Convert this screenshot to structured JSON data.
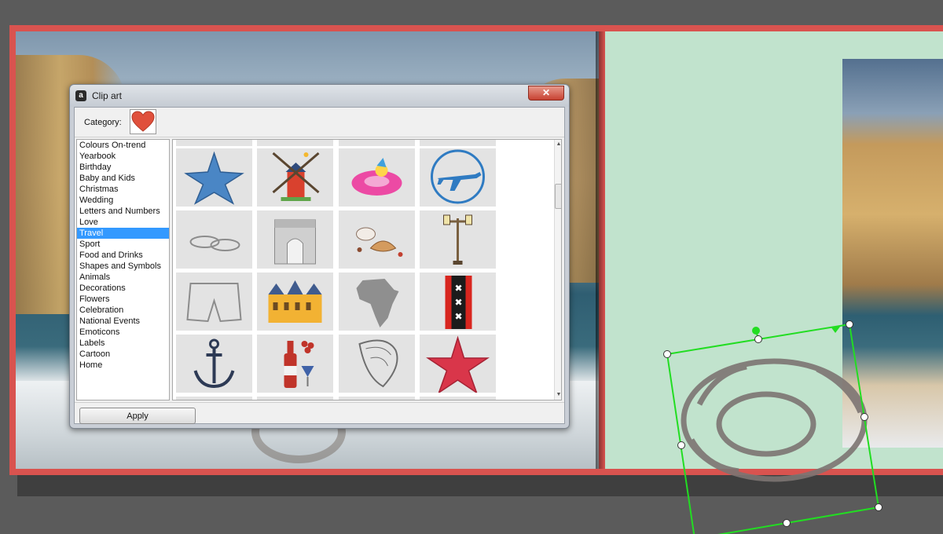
{
  "dialog": {
    "title": "Clip art",
    "close_glyph": "✕",
    "app_icon_glyph": "a",
    "category_label": "Category:",
    "category_icon": "heart-icon",
    "apply_label": "Apply"
  },
  "categories": [
    {
      "label": "Colours On-trend",
      "selected": false
    },
    {
      "label": "Yearbook",
      "selected": false
    },
    {
      "label": "Birthday",
      "selected": false
    },
    {
      "label": "Baby and Kids",
      "selected": false
    },
    {
      "label": "Christmas",
      "selected": false
    },
    {
      "label": "Wedding",
      "selected": false
    },
    {
      "label": "Letters and Numbers",
      "selected": false
    },
    {
      "label": "Love",
      "selected": false
    },
    {
      "label": "Travel",
      "selected": true
    },
    {
      "label": "Sport",
      "selected": false
    },
    {
      "label": "Food and Drinks",
      "selected": false
    },
    {
      "label": "Shapes and Symbols",
      "selected": false
    },
    {
      "label": "Animals",
      "selected": false
    },
    {
      "label": "Decorations",
      "selected": false
    },
    {
      "label": "Flowers",
      "selected": false
    },
    {
      "label": "Celebration",
      "selected": false
    },
    {
      "label": "National Events",
      "selected": false
    },
    {
      "label": "Emoticons",
      "selected": false
    },
    {
      "label": "Labels",
      "selected": false
    },
    {
      "label": "Cartoon",
      "selected": false
    },
    {
      "label": "Home",
      "selected": false
    }
  ],
  "clipart": [
    [
      "starfish-blue-icon",
      "windmill-icon",
      "swim-ring-icon",
      "airplane-icon"
    ],
    [
      "flip-flops-icon",
      "arc-de-triomphe-icon",
      "croissant-coffee-icon",
      "street-lamp-icon"
    ],
    [
      "denim-shorts-icon",
      "palace-icon",
      "africa-map-icon",
      "amsterdam-flag-icon"
    ],
    [
      "anchor-icon",
      "wine-bottle-icon",
      "seashell-icon",
      "starfish-red-icon"
    ]
  ],
  "colors": {
    "selection_highlight": "#3399ff",
    "page_border": "#d9534f",
    "right_page_bg": "#c1e3cd",
    "selection_frame": "#22dd22"
  }
}
